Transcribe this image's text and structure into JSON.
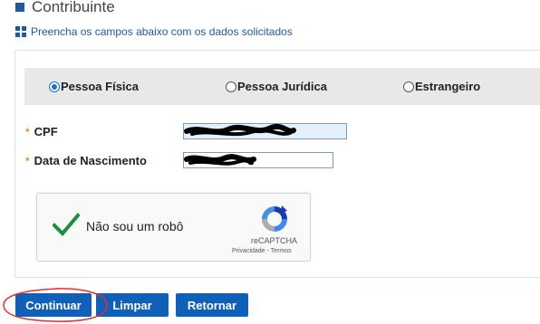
{
  "header": {
    "title": "Contribuinte",
    "instruction": "Preencha os campos abaixo com os dados solicitados"
  },
  "person_type": {
    "options": [
      {
        "label": "Pessoa Física",
        "selected": true
      },
      {
        "label": "Pessoa Jurídica",
        "selected": false
      },
      {
        "label": "Estrangeiro",
        "selected": false
      }
    ]
  },
  "fields": {
    "cpf": {
      "label": "CPF",
      "required_marker": "*",
      "value_redacted": true
    },
    "birth_date": {
      "label": "Data de Nascimento",
      "required_marker": "*",
      "value_redacted": true
    }
  },
  "captcha": {
    "label": "Não sou um robô",
    "checked": true,
    "brand": "reCAPTCHA",
    "links": "Privacidade - Termos"
  },
  "buttons": {
    "continue": "Continuar",
    "clear": "Limpar",
    "back": "Retornar"
  },
  "colors": {
    "primary": "#1060b8",
    "header_square": "#1f5a9e",
    "required_star": "#e8902a",
    "check_green": "#1e8e3e",
    "highlight_circle": "#e03030"
  },
  "annotations": {
    "highlighted_element": "continue-button"
  }
}
